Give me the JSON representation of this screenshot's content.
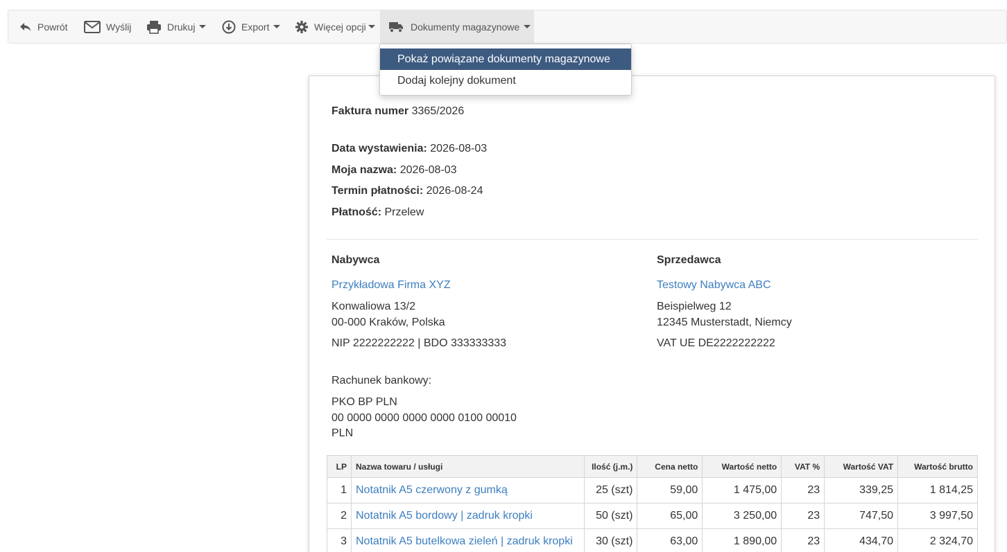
{
  "toolbar": {
    "back": "Powrót",
    "send": "Wyślij",
    "print": "Drukuj",
    "export": "Export",
    "more": "Więcej opcji",
    "warehouse": "Dokumenty magazynowe"
  },
  "dropdown": {
    "items": [
      "Pokaż powiązane dokumenty magazynowe",
      "Dodaj kolejny dokument"
    ]
  },
  "invoice": {
    "number_label": "Faktura numer",
    "number": "3365/2026",
    "issue_date_label": "Data wystawienia:",
    "issue_date": "2026-08-03",
    "my_name_label": "Moja nazwa:",
    "my_name": "2026-08-03",
    "due_date_label": "Termin płatności:",
    "due_date": "2026-08-24",
    "payment_label": "Płatność:",
    "payment": "Przelew"
  },
  "buyer": {
    "heading": "Nabywca",
    "name": "Przykładowa Firma XYZ",
    "street": "Konwaliowa 13/2",
    "city": "00-000 Kraków, Polska",
    "ids": "NIP 2222222222 | BDO 333333333"
  },
  "seller": {
    "heading": "Sprzedawca",
    "name": "Testowy Nabywca ABC",
    "street": "Beispielweg 12",
    "city": "12345 Musterstadt, Niemcy",
    "ids": "VAT UE DE2222222222"
  },
  "bank": {
    "label": "Rachunek bankowy:",
    "bank_name": "PKO BP PLN",
    "account": "00 0000 0000 0000 0000 0100 00010",
    "currency": "PLN"
  },
  "table": {
    "headers": [
      "LP",
      "Nazwa towaru / usługi",
      "Ilość (j.m.)",
      "Cena netto",
      "Wartość netto",
      "VAT %",
      "Wartość VAT",
      "Wartość brutto"
    ],
    "rows": [
      [
        "1",
        "Notatnik A5 czerwony z gumką",
        "25 (szt)",
        "59,00",
        "1 475,00",
        "23",
        "339,25",
        "1 814,25"
      ],
      [
        "2",
        "Notatnik A5 bordowy | zadruk kropki",
        "50 (szt)",
        "65,00",
        "3 250,00",
        "23",
        "747,50",
        "3 997,50"
      ],
      [
        "3",
        "Notatnik A5 butelkowa zieleń | zadruk kropki",
        "30 (szt)",
        "63,00",
        "1 890,00",
        "23",
        "434,70",
        "2 324,70"
      ]
    ]
  },
  "colors": {
    "accent": "#3d5a80",
    "link": "#3d7ebf",
    "toolbar_bg": "#f7f7f7"
  }
}
